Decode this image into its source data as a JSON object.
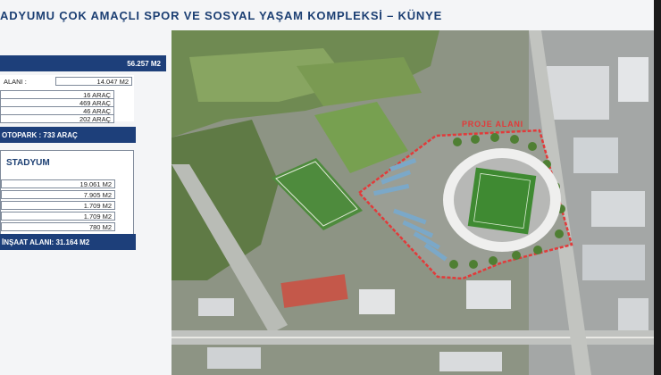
{
  "slide": {
    "title": "ADYUMU ÇOK AMAÇLI SPOR VE SOSYAL YAŞAM KOMPLEKSİ – KÜNYE",
    "area_value": "56.257 M2",
    "parking_area_label": "ALANI :",
    "parking_area_value": "14.047 M2",
    "parking_rows": [
      "16 ARAÇ",
      "469 ARAÇ",
      "46 ARAÇ",
      "202 ARAÇ"
    ],
    "parking_total": "OTOPARK : 733 ARAÇ",
    "stadium_heading": "STADYUM",
    "stadium_rows": [
      "19.061 M2",
      "7.905 M2",
      "1.709 M2",
      "1.709 M2",
      "780 M2"
    ],
    "stadium_total": "İNŞAAT ALANI: 31.164 M2"
  },
  "map": {
    "project_label": "PROJE ALANI"
  },
  "colors": {
    "navy": "#1d3f7a",
    "project_border": "#e23a3a",
    "pitch": "#3f8a32"
  }
}
